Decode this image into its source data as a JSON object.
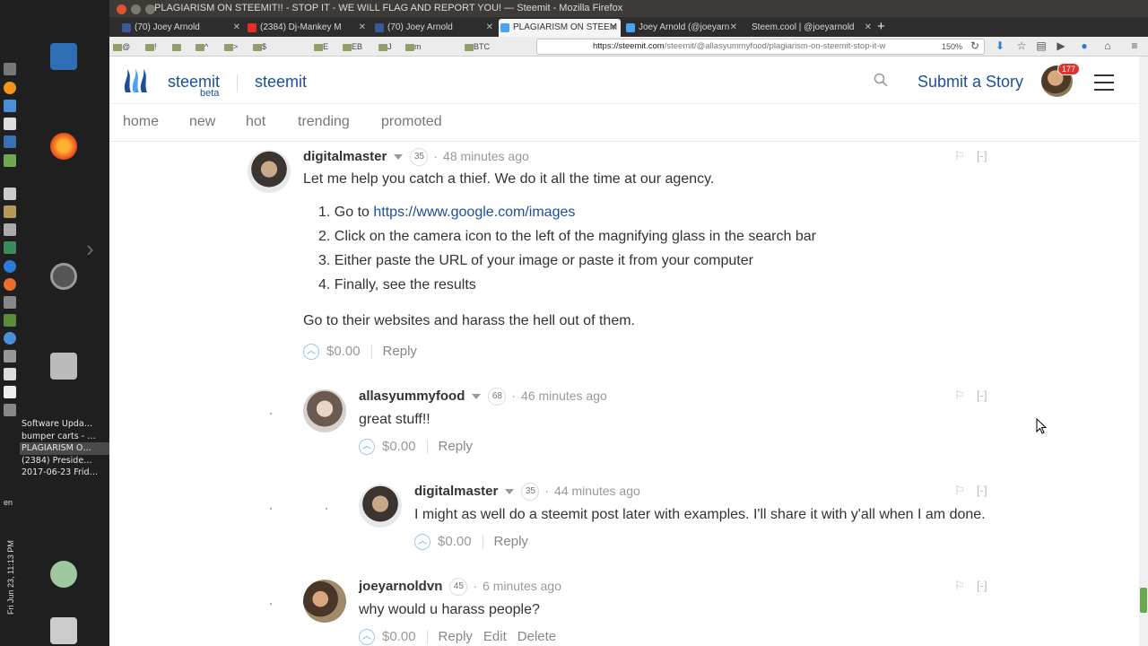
{
  "os": {
    "window_title": "PLAGIARISM ON STEEMIT!! - STOP IT - WE WILL FLAG AND REPORT YOU! — Steemit - Mozilla Firefox",
    "window_list": [
      "Software Upda…",
      "bumper carts - …",
      "PLAGIARISM O…",
      "(2384) Preside…",
      "2017-06-23 Frid…"
    ],
    "clock": "Fri Jun 23, 11:13 PM",
    "lang": "en"
  },
  "browser": {
    "tabs": [
      {
        "label": "(70) Joey Arnold",
        "fav_color": "#3b5998",
        "active": false
      },
      {
        "label": "(2384) Dj-Mankey M",
        "fav_color": "#e52d27",
        "active": false
      },
      {
        "label": "(70) Joey Arnold",
        "fav_color": "#3b5998",
        "active": false
      },
      {
        "label": "PLAGIARISM ON STEEM",
        "fav_color": "#4ba2f2",
        "active": true
      },
      {
        "label": "Joey Arnold (@joeyarn",
        "fav_color": "#4ba2f2",
        "active": false
      },
      {
        "label": "Steem.cool | @joeyarnold",
        "fav_color": "#888888",
        "active": false
      }
    ],
    "bookmarks": [
      "@",
      "!",
      "",
      "^",
      ">",
      "$",
      "E",
      "EB",
      "J",
      "m",
      "BTC"
    ],
    "url_host": "https://steemit.com",
    "url_path": "/steemit/@allasyummyfood/plagiarism-on-steemit-stop-it-w",
    "zoom": "150%"
  },
  "header": {
    "brand": "steemit",
    "beta": "beta",
    "section": "steemit",
    "submit_label": "Submit a Story",
    "notif_count": "177"
  },
  "subnav": [
    "home",
    "new",
    "hot",
    "trending",
    "promoted"
  ],
  "comments": [
    {
      "author": "digitalmaster",
      "rep": "35",
      "time": "48 minutes ago",
      "intro": "Let me help you catch a thief. We do it all the time at our agency.",
      "steps": [
        {
          "num": "1.",
          "text": "Go to ",
          "link": "https://www.google.com/images"
        },
        {
          "num": "2.",
          "text": "Click on the camera icon to the left of the magnifying glass in the search bar"
        },
        {
          "num": "3.",
          "text": "Either paste the URL of your image or paste it from your computer"
        },
        {
          "num": "4.",
          "text": "Finally, see the results"
        }
      ],
      "outro": "Go to their websites and harass the hell out of them.",
      "payout": "$0.00",
      "actions": [
        "Reply"
      ]
    },
    {
      "author": "allasyummyfood",
      "rep": "68",
      "time": "46 minutes ago",
      "body": "great stuff!!",
      "payout": "$0.00",
      "actions": [
        "Reply"
      ]
    },
    {
      "author": "digitalmaster",
      "rep": "35",
      "time": "44 minutes ago",
      "body": "I might as well do a steemit post later with examples. I'll share it with y'all when I am done.",
      "payout": "$0.00",
      "actions": [
        "Reply"
      ]
    },
    {
      "author": "joeyarnoldvn",
      "rep": "45",
      "time": "6 minutes ago",
      "body": "why would u harass people?",
      "payout": "$0.00",
      "actions": [
        "Reply",
        "Edit",
        "Delete"
      ]
    }
  ],
  "collapse_label": "[-]",
  "colors": {
    "brand": "#1a5099",
    "vote": "#4aa3df",
    "scroll_thumb": "#6aa84f"
  }
}
